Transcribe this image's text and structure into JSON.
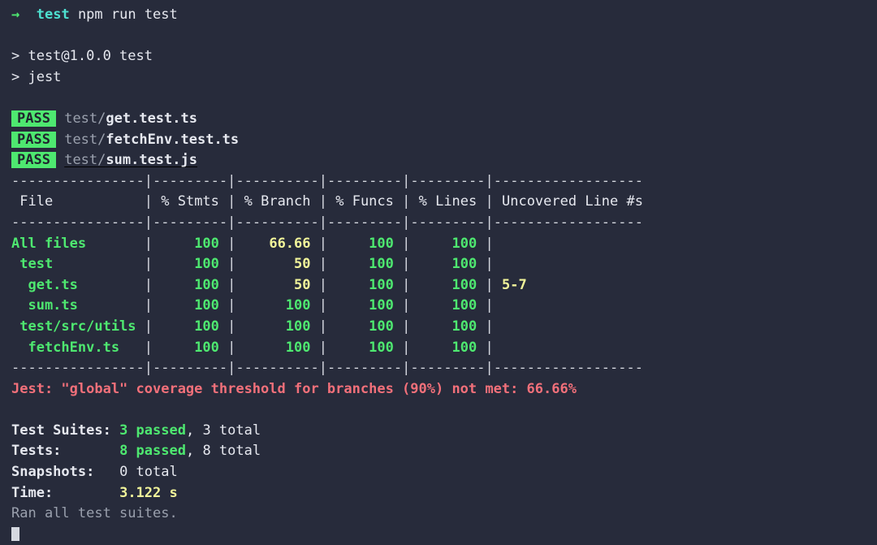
{
  "terminal": {
    "prompt": {
      "arrow": "→",
      "cwd": "test",
      "command": "npm run test"
    },
    "npm_lines": [
      "> test@1.0.0 test",
      "> jest"
    ],
    "suites": [
      {
        "status": "PASS",
        "dir": "test/",
        "file": "get.test.ts",
        "underline": false
      },
      {
        "status": "PASS",
        "dir": "test/",
        "file": "fetchEnv.test.ts",
        "underline": false
      },
      {
        "status": "PASS",
        "dir": "test/",
        "file": "sum.test.js",
        "underline": true
      }
    ],
    "coverage_table": {
      "headers": [
        "File",
        "% Stmts",
        "% Branch",
        "% Funcs",
        "% Lines",
        "Uncovered Line #s"
      ],
      "rows": [
        {
          "file": "All files",
          "indent": 0,
          "stmts": "100",
          "stmts_color": "green",
          "branch": "66.66",
          "branch_color": "yellow",
          "funcs": "100",
          "funcs_color": "green",
          "lines": "100",
          "lines_color": "green",
          "uncovered": ""
        },
        {
          "file": "test",
          "indent": 1,
          "stmts": "100",
          "stmts_color": "green",
          "branch": "50",
          "branch_color": "yellow",
          "funcs": "100",
          "funcs_color": "green",
          "lines": "100",
          "lines_color": "green",
          "uncovered": ""
        },
        {
          "file": "get.ts",
          "indent": 2,
          "stmts": "100",
          "stmts_color": "green",
          "branch": "50",
          "branch_color": "yellow",
          "funcs": "100",
          "funcs_color": "green",
          "lines": "100",
          "lines_color": "green",
          "uncovered": "5-7"
        },
        {
          "file": "sum.ts",
          "indent": 2,
          "stmts": "100",
          "stmts_color": "green",
          "branch": "100",
          "branch_color": "green",
          "funcs": "100",
          "funcs_color": "green",
          "lines": "100",
          "lines_color": "green",
          "uncovered": ""
        },
        {
          "file": "test/src/utils",
          "indent": 1,
          "stmts": "100",
          "stmts_color": "green",
          "branch": "100",
          "branch_color": "green",
          "funcs": "100",
          "funcs_color": "green",
          "lines": "100",
          "lines_color": "green",
          "uncovered": ""
        },
        {
          "file": "fetchEnv.ts",
          "indent": 2,
          "stmts": "100",
          "stmts_color": "green",
          "branch": "100",
          "branch_color": "green",
          "funcs": "100",
          "funcs_color": "green",
          "lines": "100",
          "lines_color": "green",
          "uncovered": ""
        }
      ]
    },
    "threshold_error": "Jest: \"global\" coverage threshold for branches (90%) not met: 66.66%",
    "summary": {
      "suites_label": "Test Suites:",
      "suites_passed": "3 passed",
      "suites_rest": ", 3 total",
      "tests_label": "Tests:",
      "tests_passed": "8 passed",
      "tests_rest": ", 8 total",
      "snapshots_label": "Snapshots:",
      "snapshots_value": "0 total",
      "time_label": "Time:",
      "time_value": "3.122 s",
      "ran_all": "Ran all test suites."
    },
    "colors": {
      "background": "#272b3b",
      "green": "#4ee870",
      "yellow": "#f2f59a",
      "red": "#f2707a",
      "cyan": "#4de0d0",
      "white": "#e6e8ef",
      "dim": "#9aa0ad"
    }
  }
}
